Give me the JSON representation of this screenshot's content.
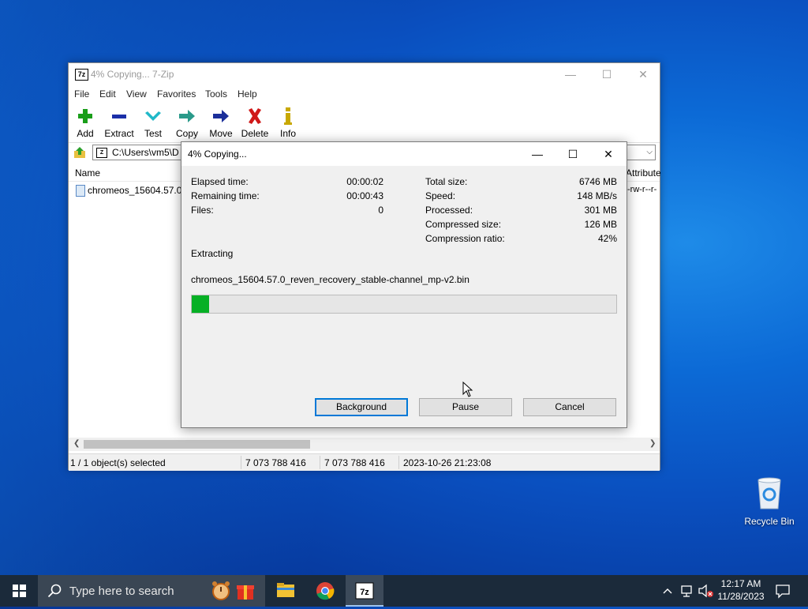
{
  "main_window": {
    "title": "4% Copying... 7-Zip",
    "app_icon_text": "7z",
    "controls": {
      "minimize": "—",
      "maximize": "☐",
      "close": "✕"
    },
    "menu": [
      "File",
      "Edit",
      "View",
      "Favorites",
      "Tools",
      "Help"
    ],
    "toolbar": [
      "Add",
      "Extract",
      "Test",
      "Copy",
      "Move",
      "Delete",
      "Info"
    ],
    "address": "C:\\Users\\vm5\\D",
    "columns": {
      "name": "Name",
      "attributes": "Attribute"
    },
    "files": [
      {
        "name": "chromeos_15604.57.0_",
        "attributes": "-rw-r--r-"
      }
    ],
    "status": {
      "selected": "1 / 1 object(s) selected",
      "size": "7 073 788 416",
      "packed": "7 073 788 416",
      "modified": "2023-10-26 21:23:08"
    }
  },
  "dialog": {
    "title": "4% Copying...",
    "left_stats": [
      {
        "label": "Elapsed time:",
        "value": "00:00:02"
      },
      {
        "label": "Remaining time:",
        "value": "00:00:43"
      },
      {
        "label": "Files:",
        "value": "0"
      }
    ],
    "right_stats": [
      {
        "label": "Total size:",
        "value": "6746 MB"
      },
      {
        "label": "Speed:",
        "value": "148 MB/s"
      },
      {
        "label": "Processed:",
        "value": "301 MB"
      },
      {
        "label": "Compressed size:",
        "value": "126 MB"
      },
      {
        "label": "Compression ratio:",
        "value": "42%"
      }
    ],
    "operation": "Extracting",
    "current_file": "chromeos_15604.57.0_reven_recovery_stable-channel_mp-v2.bin",
    "progress_fraction": 0.04,
    "buttons": {
      "background": "Background",
      "pause": "Pause",
      "cancel": "Cancel"
    }
  },
  "desktop": {
    "recycle_bin": "Recycle Bin"
  },
  "taskbar": {
    "search_placeholder": "Type here to search",
    "time": "12:17 AM",
    "date": "11/28/2023"
  },
  "colors": {
    "progress_fill": "#06b025",
    "default_button_border": "#0078d7",
    "taskbar": "#1b2a3a"
  }
}
